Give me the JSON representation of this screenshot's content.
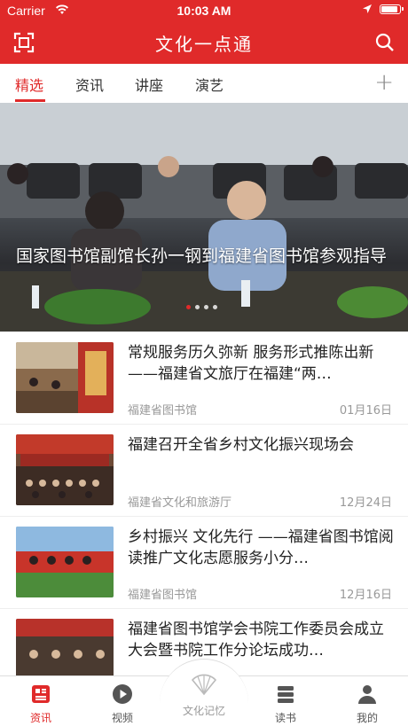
{
  "status_bar": {
    "carrier": "Carrier",
    "time": "10:03 AM"
  },
  "header": {
    "title": "文化一点通"
  },
  "tabs": [
    {
      "label": "精选",
      "active": true
    },
    {
      "label": "资讯",
      "active": false
    },
    {
      "label": "讲座",
      "active": false
    },
    {
      "label": "演艺",
      "active": false
    }
  ],
  "banner": {
    "caption": "国家图书馆副馆长孙一钢到福建省图书馆参观指导",
    "slide_count": 4,
    "active_slide": 1
  },
  "news": [
    {
      "title": "常规服务历久弥新 服务形式推陈出新 ——福建省文旅厅在福建“两…",
      "source": "福建省图书馆",
      "date": "01月16日"
    },
    {
      "title": "福建召开全省乡村文化振兴现场会",
      "source": "福建省文化和旅游厅",
      "date": "12月24日"
    },
    {
      "title": "乡村振兴 文化先行 ——福建省图书馆阅读推广文化志愿服务小分…",
      "source": "福建省图书馆",
      "date": "12月16日"
    },
    {
      "title": "福建省图书馆学会书院工作委员会成立大会暨书院工作分论坛成功…",
      "source": "",
      "date": ""
    }
  ],
  "tab_bar": [
    {
      "label": "资讯",
      "active": true
    },
    {
      "label": "视频",
      "active": false
    },
    {
      "label": "文化记忆",
      "active": false
    },
    {
      "label": "读书",
      "active": false
    },
    {
      "label": "我的",
      "active": false
    }
  ],
  "colors": {
    "brand": "#e02a2a"
  }
}
